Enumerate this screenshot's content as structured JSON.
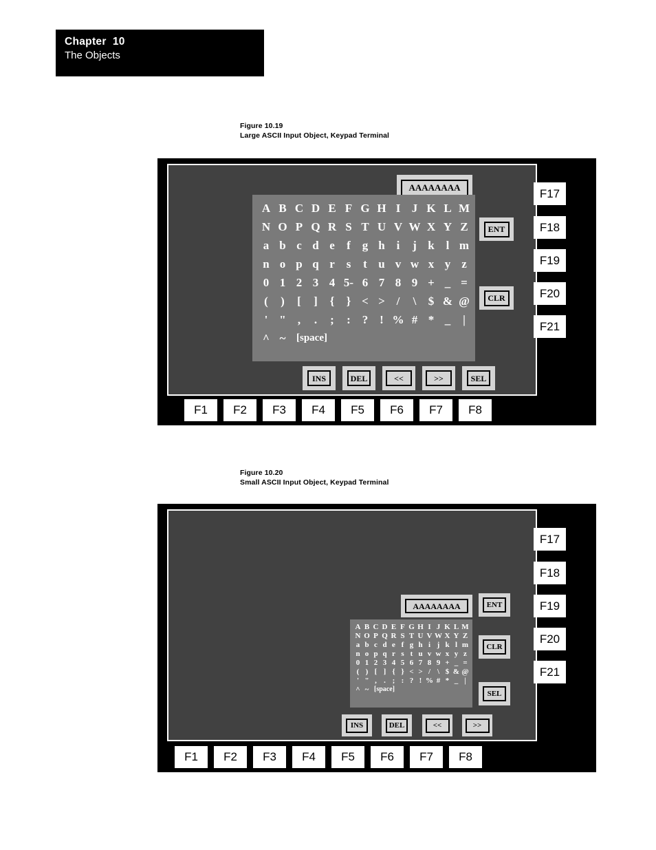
{
  "chapter": {
    "number_line": "Chapter  10",
    "title_line": "The Objects"
  },
  "figures": [
    {
      "id": "figure-10-19",
      "caption_number": "Figure 10.19",
      "caption_title": "Large ASCII Input Object, Keypad Terminal",
      "display_value": "AAAAAAAA",
      "side_buttons": [
        "ENT",
        "CLR"
      ],
      "bottom_buttons": [
        "INS",
        "DEL",
        "<<",
        ">>",
        "SEL"
      ],
      "function_keys_bottom": [
        "F1",
        "F2",
        "F3",
        "F4",
        "F5",
        "F6",
        "F7",
        "F8"
      ],
      "function_keys_right": [
        "F17",
        "F18",
        "F19",
        "F20",
        "F21"
      ],
      "keypad_rows": [
        [
          "A",
          "B",
          "C",
          "D",
          "E",
          "F",
          "G",
          "H",
          "I",
          "J",
          "K",
          "L",
          "M"
        ],
        [
          "N",
          "O",
          "P",
          "Q",
          "R",
          "S",
          "T",
          "U",
          "V",
          "W",
          "X",
          "Y",
          "Z"
        ],
        [
          "a",
          "b",
          "c",
          "d",
          "e",
          "f",
          "g",
          "h",
          "i",
          "j",
          "k",
          "l",
          "m"
        ],
        [
          "n",
          "o",
          "p",
          "q",
          "r",
          "s",
          "t",
          "u",
          "v",
          "w",
          "x",
          "y",
          "z"
        ],
        [
          "0",
          "1",
          "2",
          "3",
          "4",
          "5-",
          "6",
          "7",
          "8",
          "9",
          "+",
          "_",
          "="
        ],
        [
          "(",
          ")",
          "[",
          "]",
          "{",
          "}",
          "<",
          ">",
          "/",
          "\\",
          "$",
          "&",
          "@"
        ],
        [
          "'",
          "\"",
          ",",
          ".",
          ";",
          ":",
          "?",
          "!",
          "%",
          "#",
          "*",
          "_",
          "|"
        ],
        [
          "^",
          "~",
          "[space]"
        ]
      ]
    },
    {
      "id": "figure-10-20",
      "caption_number": "Figure 10.20",
      "caption_title": "Small ASCII Input Object, Keypad Terminal",
      "display_value": "AAAAAAAA",
      "side_buttons": [
        "ENT",
        "CLR",
        "SEL"
      ],
      "bottom_buttons": [
        "INS",
        "DEL",
        "<<",
        ">>"
      ],
      "function_keys_bottom": [
        "F1",
        "F2",
        "F3",
        "F4",
        "F5",
        "F6",
        "F7",
        "F8"
      ],
      "function_keys_right": [
        "F17",
        "F18",
        "F19",
        "F20",
        "F21"
      ],
      "keypad_rows": [
        [
          "A",
          "B",
          "C",
          "D",
          "E",
          "F",
          "G",
          "H",
          "I",
          "J",
          "K",
          "L",
          "M"
        ],
        [
          "N",
          "O",
          "P",
          "Q",
          "R",
          "S",
          "T",
          "U",
          "V",
          "W",
          "X",
          "Y",
          "Z"
        ],
        [
          "a",
          "b",
          "c",
          "d",
          "e",
          "f",
          "g",
          "h",
          "i",
          "j",
          "k",
          "l",
          "m"
        ],
        [
          "n",
          "o",
          "p",
          "q",
          "r",
          "s",
          "t",
          "u",
          "v",
          "w",
          "x",
          "y",
          "z"
        ],
        [
          "0",
          "1",
          "2",
          "3",
          "4",
          "5",
          "6",
          "7",
          "8",
          "9",
          "+",
          "_",
          "="
        ],
        [
          "(",
          ")",
          "[",
          "]",
          "{",
          "}",
          "<",
          ">",
          "/",
          "\\",
          "$",
          "&",
          "@"
        ],
        [
          "'",
          "\"",
          ",",
          ".",
          ";",
          ":",
          "?",
          "!",
          "%",
          "#",
          "*",
          "_",
          "|"
        ],
        [
          "^",
          "~",
          "[space]"
        ]
      ]
    }
  ],
  "colors": {
    "bezel": "#000000",
    "screen": "#414141",
    "keypad_panel": "#7a7a7a",
    "widget_plate": "#d4d4d4",
    "key_cap": "#ffffff",
    "text_on_screen": "#ffffff"
  }
}
